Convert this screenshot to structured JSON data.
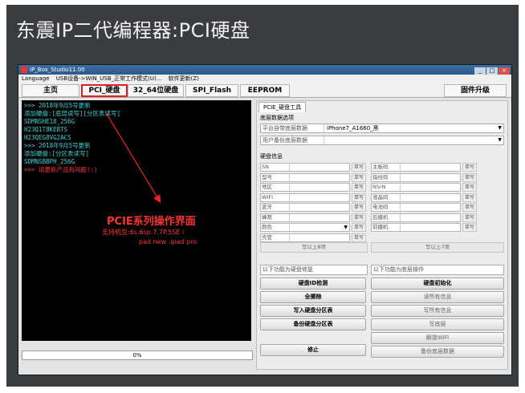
{
  "slide": {
    "title": "东震IP二代编程器:PCI硬盘"
  },
  "window": {
    "title": "IP_Box_Studio11.00",
    "controls": [
      "_",
      "□",
      "×"
    ],
    "menu": [
      "Language",
      "USB设备->WIN_USB_正常工作模式(U)...",
      "软件更新(Z)"
    ]
  },
  "tabs": [
    {
      "label": "主页"
    },
    {
      "label": "PCI_硬盘"
    },
    {
      "label": "32_64位硬盘"
    },
    {
      "label": "SPI_Flash"
    },
    {
      "label": "EEPROM"
    },
    {
      "label": "固件升级"
    }
  ],
  "console": {
    "lines": [
      {
        "text": ">>> 2018年9月5号更新",
        "color": "cyan"
      },
      {
        "text": "    添加硬盘:[底层读写][分区表读写]",
        "color": "cyan"
      },
      {
        "text": "    SDMNSHE18_256G",
        "color": "cyan"
      },
      {
        "text": "    H23Q1T8KEBTS",
        "color": "cyan"
      },
      {
        "text": "    H23QEG8VG2ACS",
        "color": "cyan"
      },
      {
        "text": ">>> 2018年9月5号更新",
        "color": "cyan"
      },
      {
        "text": "    添加硬盘:[分区表读写]",
        "color": "cyan"
      },
      {
        "text": "    SDMNSBBPH_256G",
        "color": "cyan"
      },
      {
        "text": ">>> 请更新产品有问题!:)",
        "color": "red"
      }
    ]
  },
  "annotation": {
    "headline": "PCIE系列操作界面",
    "line1": "支持机型:6s.6sp.7.7P.5SE i",
    "line2": "pad new .ipad pro"
  },
  "progress": {
    "value": 0,
    "label": "0%"
  },
  "panel": {
    "tab": "PCIE_硬盘工具",
    "bottom_select_group": "底层数据选项",
    "platform_label": "平台自带底层数据",
    "platform_value": "iPhone7_A1660_黑",
    "user_backup_label": "用户备份底层数据",
    "user_backup_value": "",
    "disk_info_group": "硬盘信息",
    "left_fields": [
      "SN",
      "型号",
      "地区",
      "WIFI",
      "蓝牙",
      "蜂窝",
      "颜色",
      "壳管"
    ],
    "right_fields": [
      "主板码",
      "指纹码",
      "NSrN",
      "液晶码",
      "电池码",
      "后摄机",
      "前摄机"
    ],
    "write_btn": "单写",
    "write_all_left": "写以上8项",
    "write_all_right": "写以上7项",
    "hint_left": "以下功能为硬盘修复",
    "hint_right": "以下功能为底层操作",
    "left_actions": [
      "硬盘ID检测",
      "全擦除",
      "写入硬盘分区表",
      "备份硬盘分区表",
      "修止"
    ],
    "right_actions": [
      "硬盘初始化",
      "读所有信息",
      "写所有信息",
      "写底层",
      "解锁WiFi",
      "备份底层数据"
    ]
  }
}
